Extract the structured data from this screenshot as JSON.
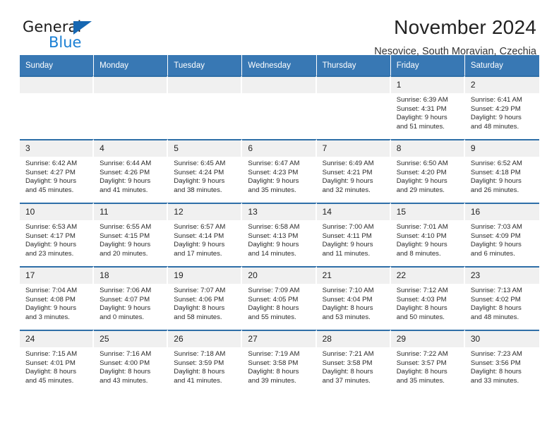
{
  "logo": {
    "word_top": "General",
    "word_bottom": "Blue",
    "triangle_color": "#1667b2",
    "blue_color": "#1a7fd4"
  },
  "header": {
    "title": "November 2024",
    "subtitle": "Nesovice, South Moravian, Czechia"
  },
  "theme": {
    "header_row_bg": "#3878b4",
    "row_divider": "#2f6fa8",
    "daynum_bg": "#f0f0f0"
  },
  "calendar": {
    "weekday_headers": [
      "Sunday",
      "Monday",
      "Tuesday",
      "Wednesday",
      "Thursday",
      "Friday",
      "Saturday"
    ],
    "weeks": [
      [
        {
          "day": "",
          "lines": []
        },
        {
          "day": "",
          "lines": []
        },
        {
          "day": "",
          "lines": []
        },
        {
          "day": "",
          "lines": []
        },
        {
          "day": "",
          "lines": []
        },
        {
          "day": "1",
          "lines": [
            "Sunrise: 6:39 AM",
            "Sunset: 4:31 PM",
            "Daylight: 9 hours",
            "and 51 minutes."
          ]
        },
        {
          "day": "2",
          "lines": [
            "Sunrise: 6:41 AM",
            "Sunset: 4:29 PM",
            "Daylight: 9 hours",
            "and 48 minutes."
          ]
        }
      ],
      [
        {
          "day": "3",
          "lines": [
            "Sunrise: 6:42 AM",
            "Sunset: 4:27 PM",
            "Daylight: 9 hours",
            "and 45 minutes."
          ]
        },
        {
          "day": "4",
          "lines": [
            "Sunrise: 6:44 AM",
            "Sunset: 4:26 PM",
            "Daylight: 9 hours",
            "and 41 minutes."
          ]
        },
        {
          "day": "5",
          "lines": [
            "Sunrise: 6:45 AM",
            "Sunset: 4:24 PM",
            "Daylight: 9 hours",
            "and 38 minutes."
          ]
        },
        {
          "day": "6",
          "lines": [
            "Sunrise: 6:47 AM",
            "Sunset: 4:23 PM",
            "Daylight: 9 hours",
            "and 35 minutes."
          ]
        },
        {
          "day": "7",
          "lines": [
            "Sunrise: 6:49 AM",
            "Sunset: 4:21 PM",
            "Daylight: 9 hours",
            "and 32 minutes."
          ]
        },
        {
          "day": "8",
          "lines": [
            "Sunrise: 6:50 AM",
            "Sunset: 4:20 PM",
            "Daylight: 9 hours",
            "and 29 minutes."
          ]
        },
        {
          "day": "9",
          "lines": [
            "Sunrise: 6:52 AM",
            "Sunset: 4:18 PM",
            "Daylight: 9 hours",
            "and 26 minutes."
          ]
        }
      ],
      [
        {
          "day": "10",
          "lines": [
            "Sunrise: 6:53 AM",
            "Sunset: 4:17 PM",
            "Daylight: 9 hours",
            "and 23 minutes."
          ]
        },
        {
          "day": "11",
          "lines": [
            "Sunrise: 6:55 AM",
            "Sunset: 4:15 PM",
            "Daylight: 9 hours",
            "and 20 minutes."
          ]
        },
        {
          "day": "12",
          "lines": [
            "Sunrise: 6:57 AM",
            "Sunset: 4:14 PM",
            "Daylight: 9 hours",
            "and 17 minutes."
          ]
        },
        {
          "day": "13",
          "lines": [
            "Sunrise: 6:58 AM",
            "Sunset: 4:13 PM",
            "Daylight: 9 hours",
            "and 14 minutes."
          ]
        },
        {
          "day": "14",
          "lines": [
            "Sunrise: 7:00 AM",
            "Sunset: 4:11 PM",
            "Daylight: 9 hours",
            "and 11 minutes."
          ]
        },
        {
          "day": "15",
          "lines": [
            "Sunrise: 7:01 AM",
            "Sunset: 4:10 PM",
            "Daylight: 9 hours",
            "and 8 minutes."
          ]
        },
        {
          "day": "16",
          "lines": [
            "Sunrise: 7:03 AM",
            "Sunset: 4:09 PM",
            "Daylight: 9 hours",
            "and 6 minutes."
          ]
        }
      ],
      [
        {
          "day": "17",
          "lines": [
            "Sunrise: 7:04 AM",
            "Sunset: 4:08 PM",
            "Daylight: 9 hours",
            "and 3 minutes."
          ]
        },
        {
          "day": "18",
          "lines": [
            "Sunrise: 7:06 AM",
            "Sunset: 4:07 PM",
            "Daylight: 9 hours",
            "and 0 minutes."
          ]
        },
        {
          "day": "19",
          "lines": [
            "Sunrise: 7:07 AM",
            "Sunset: 4:06 PM",
            "Daylight: 8 hours",
            "and 58 minutes."
          ]
        },
        {
          "day": "20",
          "lines": [
            "Sunrise: 7:09 AM",
            "Sunset: 4:05 PM",
            "Daylight: 8 hours",
            "and 55 minutes."
          ]
        },
        {
          "day": "21",
          "lines": [
            "Sunrise: 7:10 AM",
            "Sunset: 4:04 PM",
            "Daylight: 8 hours",
            "and 53 minutes."
          ]
        },
        {
          "day": "22",
          "lines": [
            "Sunrise: 7:12 AM",
            "Sunset: 4:03 PM",
            "Daylight: 8 hours",
            "and 50 minutes."
          ]
        },
        {
          "day": "23",
          "lines": [
            "Sunrise: 7:13 AM",
            "Sunset: 4:02 PM",
            "Daylight: 8 hours",
            "and 48 minutes."
          ]
        }
      ],
      [
        {
          "day": "24",
          "lines": [
            "Sunrise: 7:15 AM",
            "Sunset: 4:01 PM",
            "Daylight: 8 hours",
            "and 45 minutes."
          ]
        },
        {
          "day": "25",
          "lines": [
            "Sunrise: 7:16 AM",
            "Sunset: 4:00 PM",
            "Daylight: 8 hours",
            "and 43 minutes."
          ]
        },
        {
          "day": "26",
          "lines": [
            "Sunrise: 7:18 AM",
            "Sunset: 3:59 PM",
            "Daylight: 8 hours",
            "and 41 minutes."
          ]
        },
        {
          "day": "27",
          "lines": [
            "Sunrise: 7:19 AM",
            "Sunset: 3:58 PM",
            "Daylight: 8 hours",
            "and 39 minutes."
          ]
        },
        {
          "day": "28",
          "lines": [
            "Sunrise: 7:21 AM",
            "Sunset: 3:58 PM",
            "Daylight: 8 hours",
            "and 37 minutes."
          ]
        },
        {
          "day": "29",
          "lines": [
            "Sunrise: 7:22 AM",
            "Sunset: 3:57 PM",
            "Daylight: 8 hours",
            "and 35 minutes."
          ]
        },
        {
          "day": "30",
          "lines": [
            "Sunrise: 7:23 AM",
            "Sunset: 3:56 PM",
            "Daylight: 8 hours",
            "and 33 minutes."
          ]
        }
      ]
    ]
  }
}
